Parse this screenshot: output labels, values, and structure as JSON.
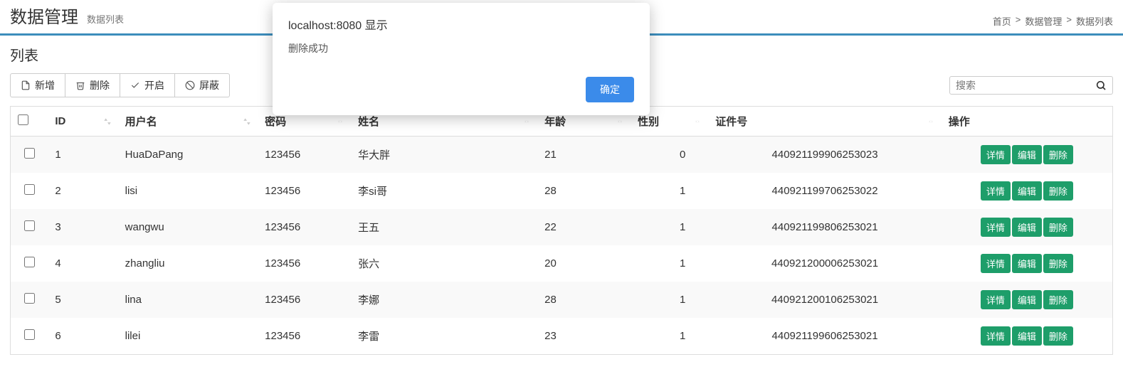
{
  "header": {
    "title_main": "数据管理",
    "title_sub": "数据列表",
    "breadcrumb_home": "首页",
    "breadcrumb_sep": ">",
    "breadcrumb_module": "数据管理",
    "breadcrumb_leaf": "数据列表"
  },
  "list_label": "列表",
  "toolbar": {
    "add": "新增",
    "delete": "删除",
    "enable": "开启",
    "block": "屏蔽"
  },
  "search": {
    "placeholder": "搜索"
  },
  "columns": {
    "id": "ID",
    "username": "用户名",
    "password": "密码",
    "name": "姓名",
    "age": "年龄",
    "gender": "性别",
    "cert": "证件号",
    "ops": "操作"
  },
  "row_actions": {
    "detail": "详情",
    "edit": "编辑",
    "delete": "删除"
  },
  "rows": [
    {
      "id": "1",
      "username": "HuaDaPang",
      "password": "123456",
      "name": "华大胖",
      "age": "21",
      "gender": "0",
      "cert": "440921199906253023"
    },
    {
      "id": "2",
      "username": "lisi",
      "password": "123456",
      "name": "李si哥",
      "age": "28",
      "gender": "1",
      "cert": "440921199706253022"
    },
    {
      "id": "3",
      "username": "wangwu",
      "password": "123456",
      "name": "王五",
      "age": "22",
      "gender": "1",
      "cert": "440921199806253021"
    },
    {
      "id": "4",
      "username": "zhangliu",
      "password": "123456",
      "name": "张六",
      "age": "20",
      "gender": "1",
      "cert": "440921200006253021"
    },
    {
      "id": "5",
      "username": "lina",
      "password": "123456",
      "name": "李娜",
      "age": "28",
      "gender": "1",
      "cert": "440921200106253021"
    },
    {
      "id": "6",
      "username": "lilei",
      "password": "123456",
      "name": "李雷",
      "age": "23",
      "gender": "1",
      "cert": "440921199606253021"
    }
  ],
  "dialog": {
    "title": "localhost:8080 显示",
    "message": "删除成功",
    "ok": "确定"
  }
}
